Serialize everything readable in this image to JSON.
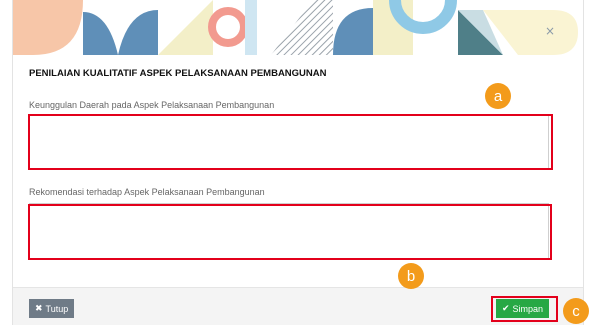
{
  "modal": {
    "close_glyph": "×",
    "title": "PENILAIAN KUALITATIF ASPEK PELAKSANAAN PEMBANGUNAN",
    "fields": [
      {
        "label": "Keunggulan Daerah pada Aspek Pelaksanaan Pembangunan",
        "value": ""
      },
      {
        "label": "Rekomendasi terhadap Aspek Pelaksanaan Pembangunan",
        "value": ""
      }
    ],
    "footer": {
      "close_label": "Tutup",
      "save_label": "Simpan"
    }
  },
  "annotations": {
    "a": "a",
    "b": "b",
    "c": "c"
  },
  "colors": {
    "highlight": "#e3001b",
    "badge": "#f39b1b",
    "save_button": "#27a844",
    "close_button": "#6f7b87"
  }
}
